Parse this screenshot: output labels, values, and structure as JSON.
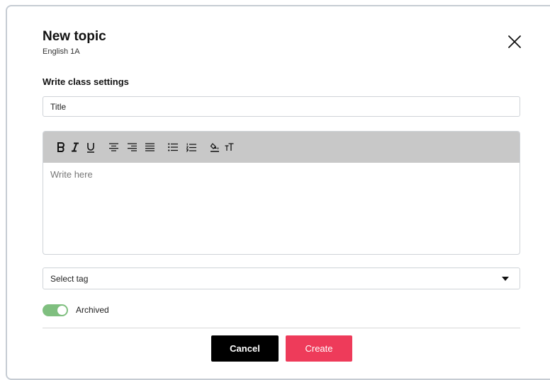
{
  "modal": {
    "title": "New topic",
    "subtitle": "English 1A",
    "close_icon": "close-icon"
  },
  "form": {
    "section_label": "Write class settings",
    "title_placeholder": "Title",
    "editor": {
      "placeholder": "Write here",
      "toolbar": [
        "bold-icon",
        "italic-icon",
        "underline-icon",
        "align-center-icon",
        "align-right-icon",
        "align-justify-icon",
        "bullet-list-icon",
        "numbered-list-icon",
        "highlight-icon",
        "font-size-icon"
      ],
      "toolbar_bg": "#c8c8c8"
    },
    "tag_select": {
      "value": "Select tag",
      "icon": "caret-down-icon"
    },
    "archived": {
      "label": "Archived",
      "on": true,
      "color": "#7fbf7f"
    }
  },
  "actions": {
    "cancel_label": "Cancel",
    "create_label": "Create",
    "create_color": "#ee3b5a",
    "cancel_color": "#000000"
  }
}
